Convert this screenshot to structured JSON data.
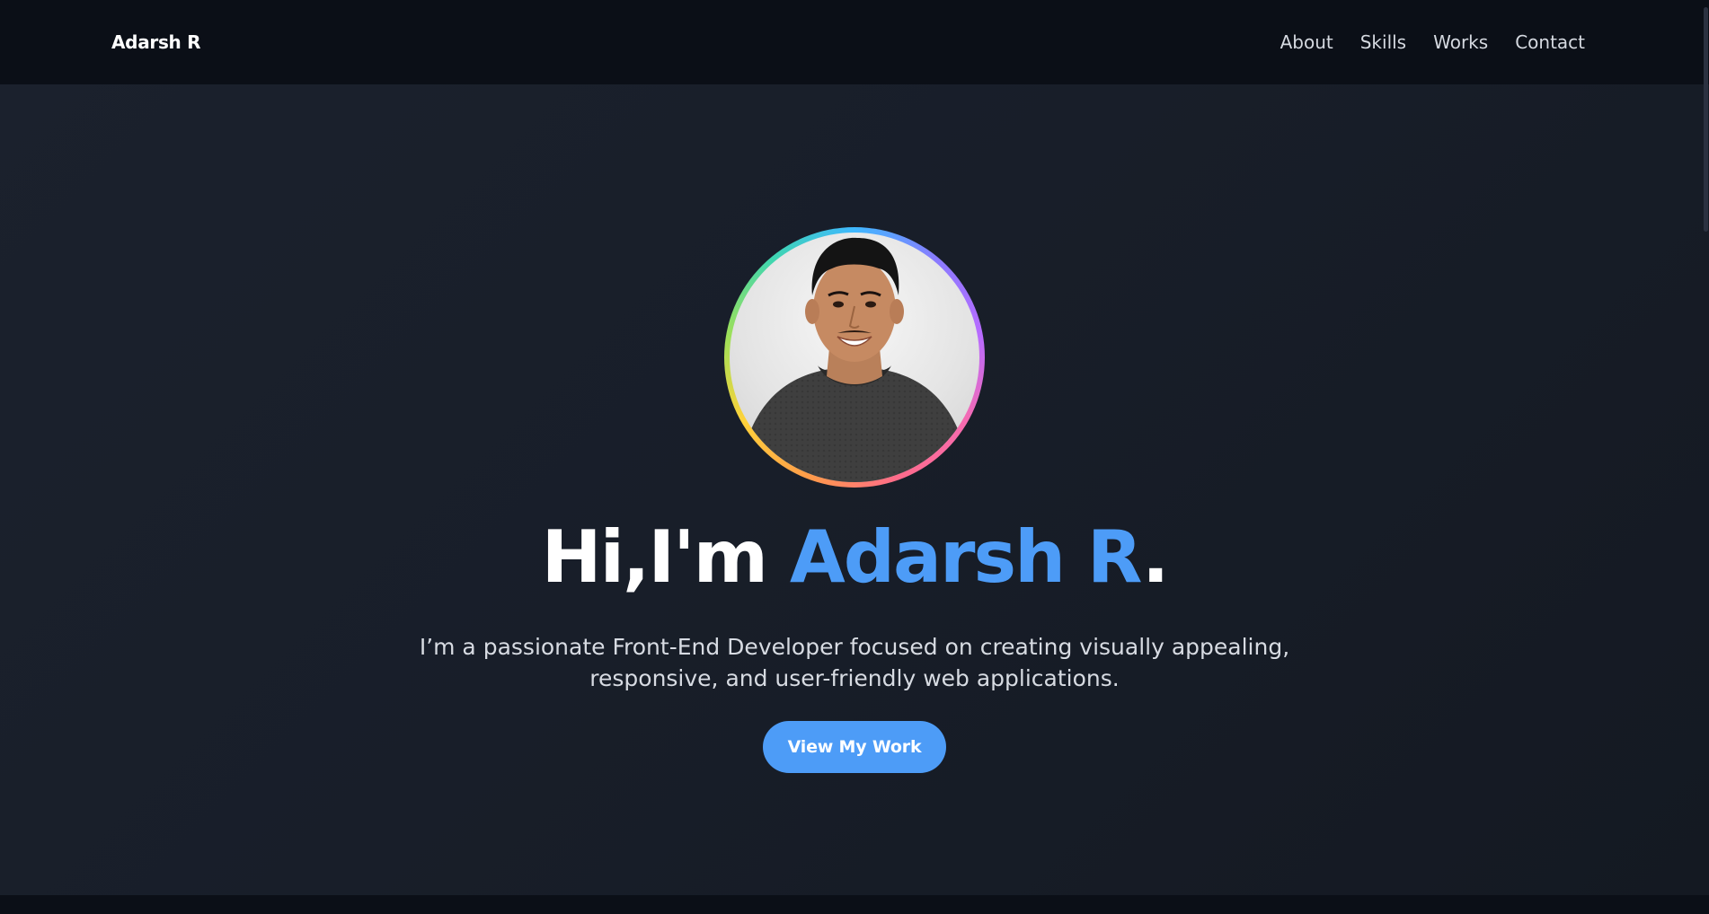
{
  "header": {
    "brand": "Adarsh R",
    "nav": [
      {
        "label": "About"
      },
      {
        "label": "Skills"
      },
      {
        "label": "Works"
      },
      {
        "label": "Contact"
      }
    ]
  },
  "hero": {
    "greeting": "Hi,I'm ",
    "name": "Adarsh R",
    "punctuation": ".",
    "description": "I’m a passionate Front-End Developer focused on creating visually appealing, responsive, and user-friendly web applications.",
    "cta_label": "View My Work"
  },
  "colors": {
    "accent": "#4d9cf7",
    "background": "#1b212d",
    "header": "#0b0f17",
    "text": "#ffffff"
  }
}
